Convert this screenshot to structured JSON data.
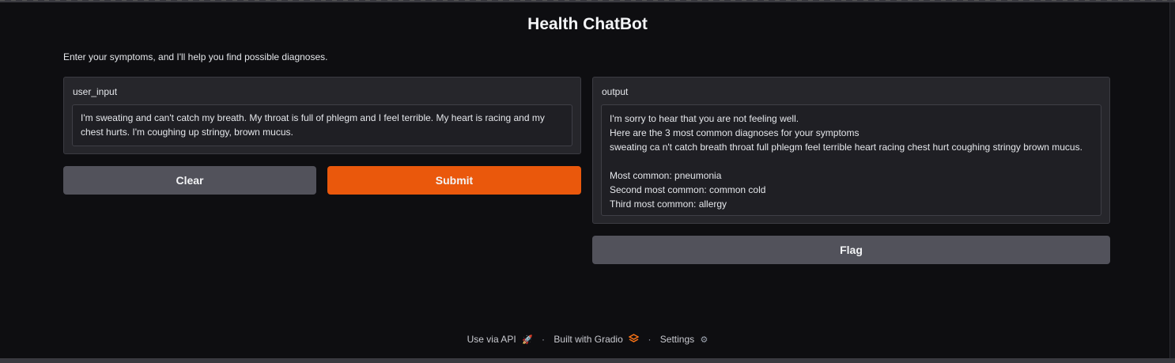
{
  "app": {
    "title": "Health ChatBot",
    "description": "Enter your symptoms, and I'll help you find possible diagnoses."
  },
  "input": {
    "label": "user_input",
    "value": "I'm sweating and can't catch my breath. My throat is full of phlegm and I feel terrible. My heart is racing and my chest hurts. I'm coughing up stringy, brown mucus."
  },
  "output": {
    "label": "output",
    "value": "I'm sorry to hear that you are not feeling well.\nHere are the 3 most common diagnoses for your symptoms\nsweating ca n't catch breath throat full phlegm feel terrible heart racing chest hurt coughing stringy brown mucus.\n\nMost common: pneumonia\nSecond most common: common cold\nThird most common: allergy"
  },
  "buttons": {
    "clear": "Clear",
    "submit": "Submit",
    "flag": "Flag"
  },
  "footer": {
    "api": "Use via API",
    "api_icon": "rocket-icon",
    "built": "Built with Gradio",
    "built_icon": "gradio-logo-icon",
    "settings": "Settings",
    "settings_icon": "gear-icon",
    "separator": "·"
  },
  "colors": {
    "background": "#0e0e11",
    "panel": "#26262b",
    "primary": "#ea580c",
    "secondary": "#52525b"
  }
}
